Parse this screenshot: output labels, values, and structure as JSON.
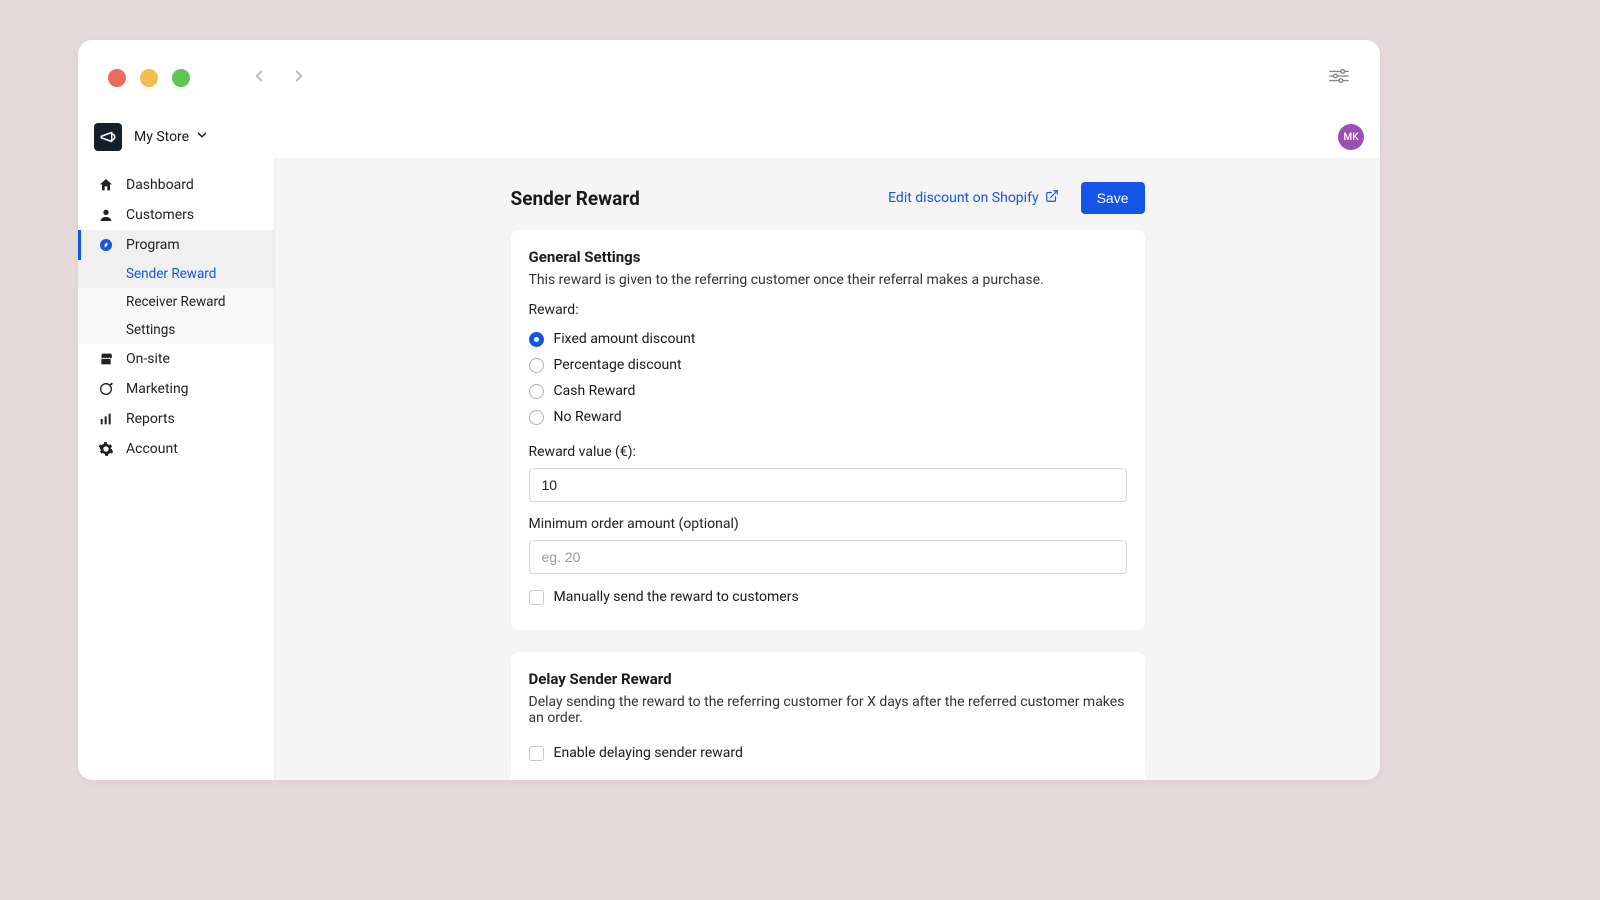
{
  "topbar": {
    "store_label": "My Store",
    "avatar_initials": "MK"
  },
  "sidebar": {
    "items": [
      {
        "label": "Dashboard"
      },
      {
        "label": "Customers"
      },
      {
        "label": "Program"
      },
      {
        "label": "On-site"
      },
      {
        "label": "Marketing"
      },
      {
        "label": "Reports"
      },
      {
        "label": "Account"
      }
    ],
    "program_sub": [
      {
        "label": "Sender Reward"
      },
      {
        "label": "Receiver Reward"
      },
      {
        "label": "Settings"
      }
    ]
  },
  "page": {
    "title": "Sender Reward",
    "edit_link": "Edit discount on Shopify",
    "save_label": "Save"
  },
  "general": {
    "title": "General Settings",
    "desc": "This reward is given to the referring customer once their referral makes a purchase.",
    "reward_label": "Reward:",
    "options": [
      "Fixed amount discount",
      "Percentage discount",
      "Cash Reward",
      "No Reward"
    ],
    "value_label": "Reward value (€):",
    "value": "10",
    "min_label": "Minimum order amount (optional)",
    "min_placeholder": "eg. 20",
    "manual_label": "Manually send the reward to customers"
  },
  "delay": {
    "title": "Delay Sender Reward",
    "desc": "Delay sending the reward to the referring customer for X days after the referred customer makes an order.",
    "enable_label": "Enable delaying sender reward"
  }
}
